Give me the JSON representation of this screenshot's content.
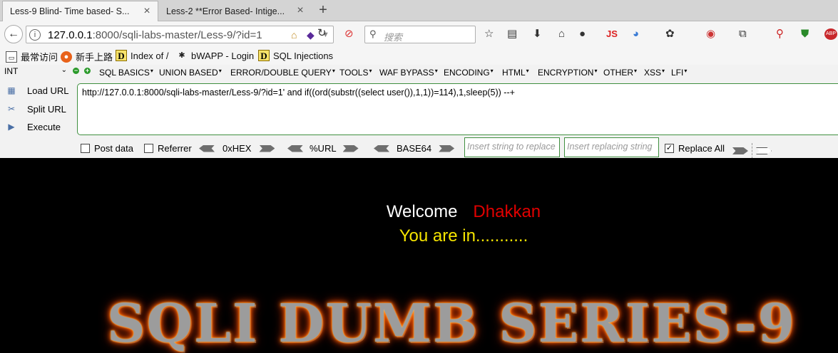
{
  "tabs": [
    {
      "label": "Less-9 Blind- Time based- S..."
    },
    {
      "label": "Less-2 **Error Based- Intige..."
    }
  ],
  "navbar": {
    "url_host": "127.0.0.1",
    "url_path": ":8000/sqli-labs-master/Less-9/?id=1",
    "search_placeholder": "搜索",
    "js_label": "JS"
  },
  "bookmarks": [
    {
      "label": "最常访问"
    },
    {
      "label": "新手上路"
    },
    {
      "label": "Index of /"
    },
    {
      "label": "bWAPP - Login"
    },
    {
      "label": "SQL Injections"
    }
  ],
  "hackbar": {
    "select_value": "INT",
    "menu": [
      "SQL BASICS",
      "UNION BASED",
      "ERROR/DOUBLE QUERY",
      "TOOLS",
      "WAF BYPASS",
      "ENCODING",
      "HTML",
      "ENCRYPTION",
      "OTHER",
      "XSS",
      "LFI"
    ],
    "load_url": "Load URL",
    "split_url": "Split URL",
    "execute": "Execute",
    "url_value": "http://127.0.0.1:8000/sqli-labs-master/Less-9/?id=1' and if((ord(substr((select user()),1,1))=114),1,sleep(5)) --+",
    "post_data": "Post data",
    "referrer": "Referrer",
    "hex": "0xHEX",
    "url_enc": "%URL",
    "base64": "BASE64",
    "replace_ph": "Insert string to replace",
    "replacing_ph": "Insert replacing string",
    "replace_all": "Replace All",
    "replace_all_checked": true,
    "post_data_checked": false,
    "referrer_checked": false
  },
  "page": {
    "welcome": "Welcome",
    "name": "Dhakkan",
    "message": "You are in...........",
    "banner": "SQLI DUMB SERIES-9"
  },
  "colors": {
    "name": "#e00000",
    "message": "#f5e400",
    "banner_glow": "#ff7a00"
  }
}
